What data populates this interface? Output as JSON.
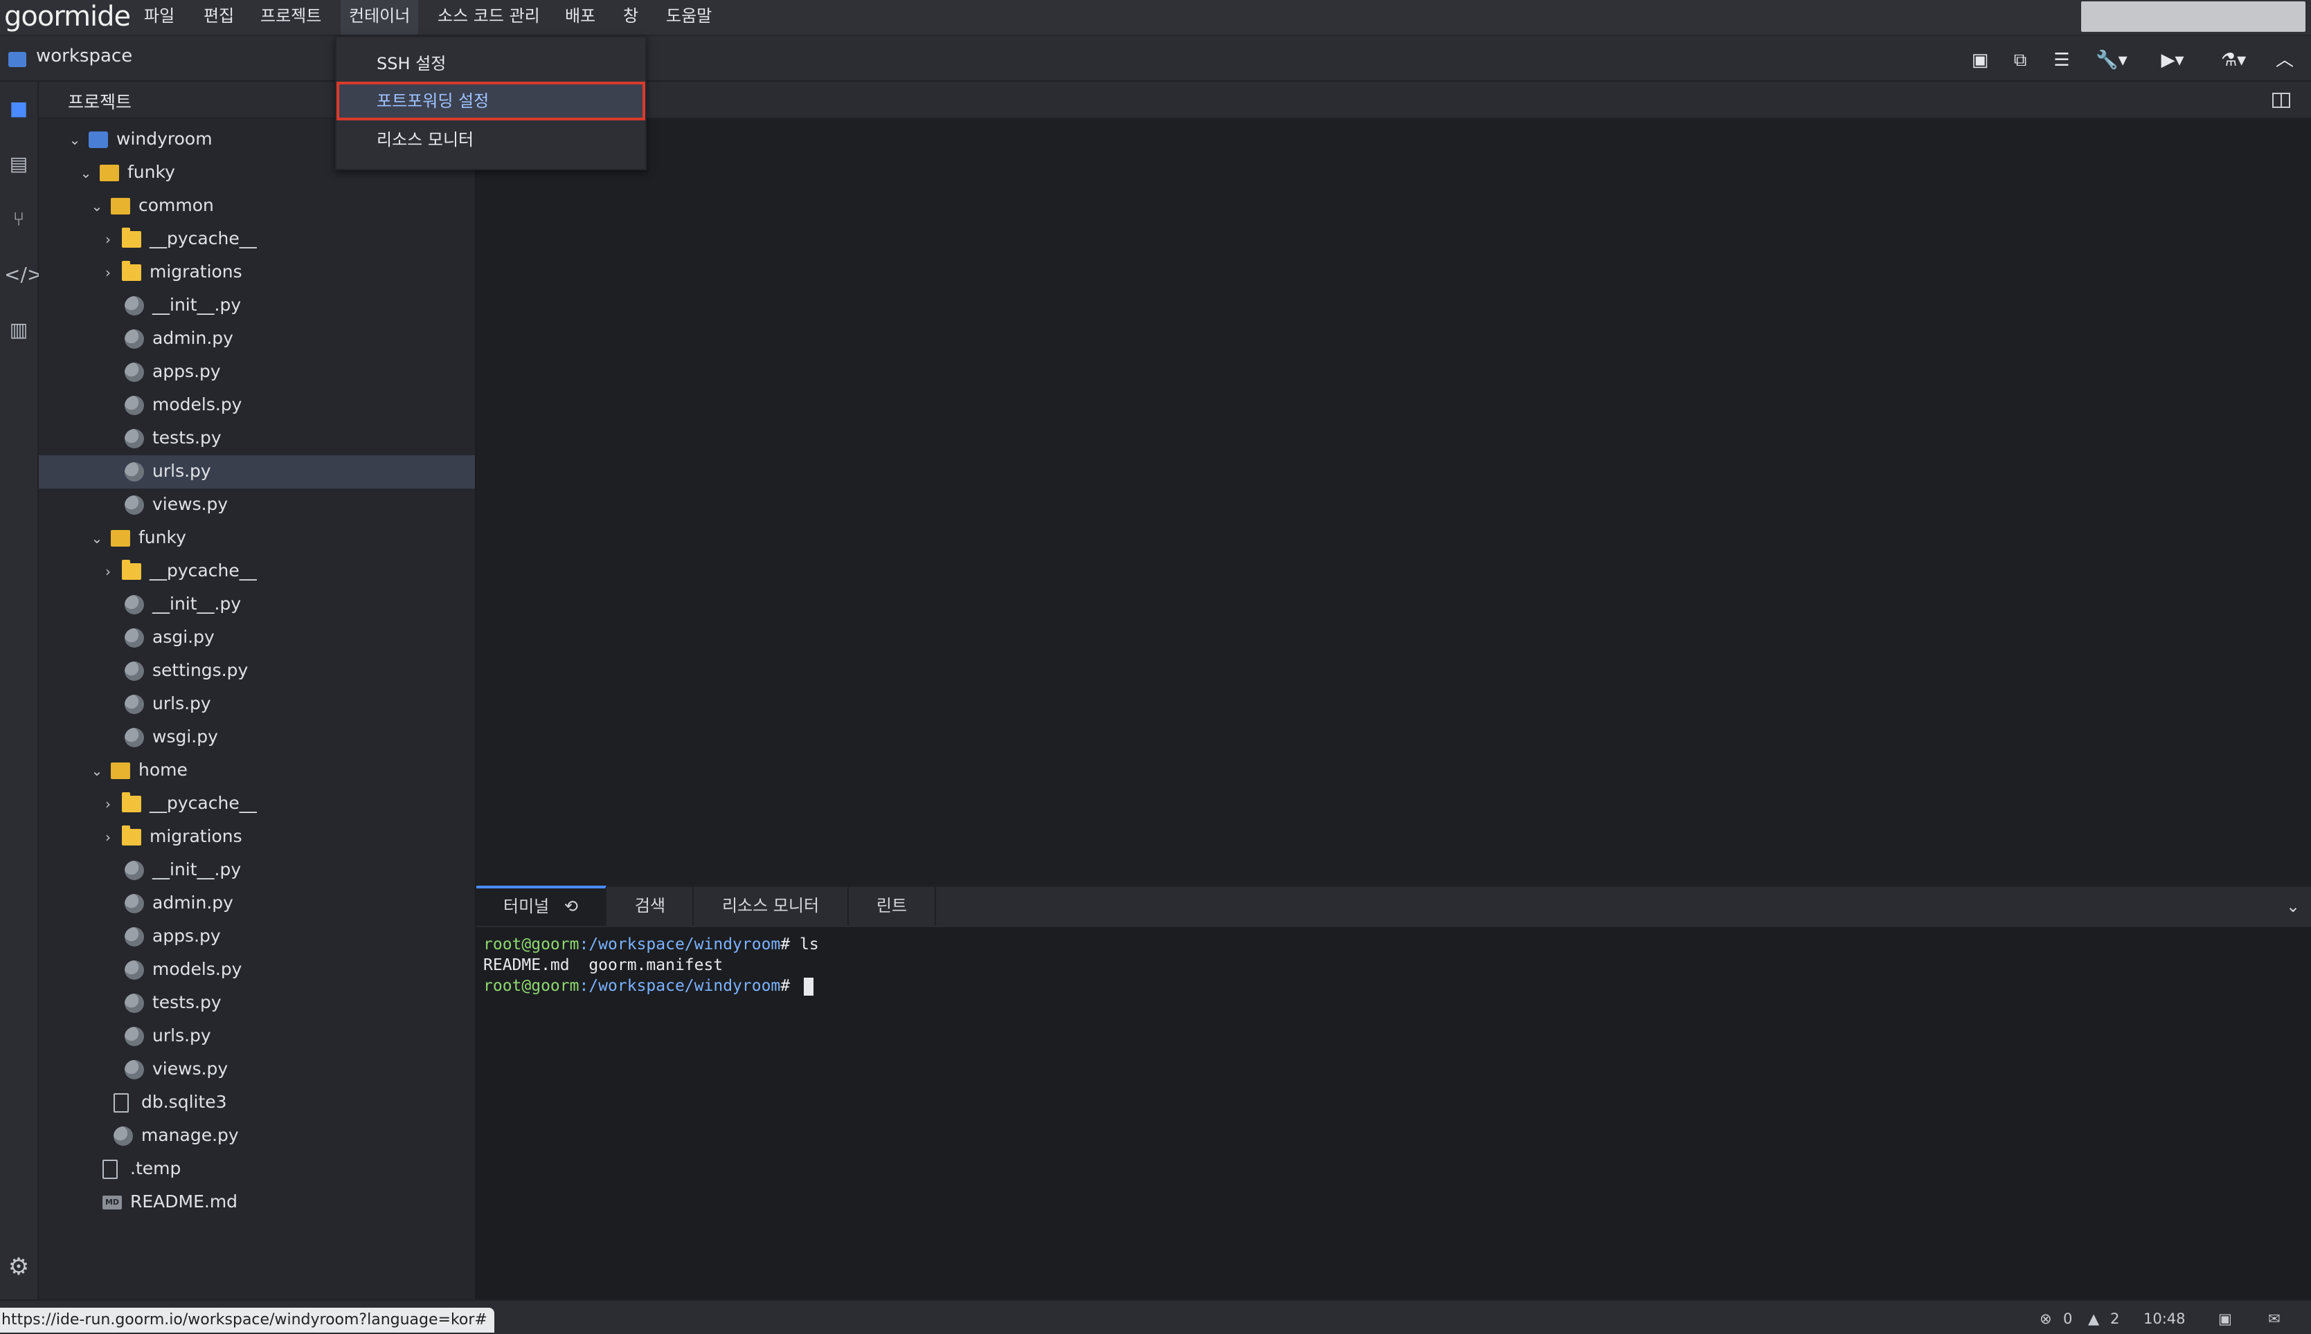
{
  "app": {
    "logo": "goormide"
  },
  "menubar": {
    "items": [
      "파일",
      "편집",
      "프로젝트",
      "컨테이너",
      "소스 코드 관리",
      "배포",
      "창",
      "도움말"
    ],
    "active_index": 3
  },
  "toolbar": {
    "workspace_label": "workspace"
  },
  "dropdown": {
    "items": [
      "SSH 설정",
      "포트포워딩 설정",
      "리소스 모니터"
    ],
    "highlighted_index": 1
  },
  "project_panel": {
    "title": "프로젝트"
  },
  "tree": [
    {
      "label": "windyroom",
      "type": "project",
      "depth": 0,
      "expanded": true
    },
    {
      "label": "funky",
      "type": "folder",
      "depth": 1,
      "expanded": true
    },
    {
      "label": "common",
      "type": "folder",
      "depth": 2,
      "expanded": true
    },
    {
      "label": "__pycache__",
      "type": "folder",
      "depth": 3,
      "expanded": false
    },
    {
      "label": "migrations",
      "type": "folder",
      "depth": 3,
      "expanded": false
    },
    {
      "label": "__init__.py",
      "type": "python",
      "depth": 3
    },
    {
      "label": "admin.py",
      "type": "python",
      "depth": 3
    },
    {
      "label": "apps.py",
      "type": "python",
      "depth": 3
    },
    {
      "label": "models.py",
      "type": "python",
      "depth": 3
    },
    {
      "label": "tests.py",
      "type": "python",
      "depth": 3
    },
    {
      "label": "urls.py",
      "type": "python",
      "depth": 3,
      "selected": true
    },
    {
      "label": "views.py",
      "type": "python",
      "depth": 3
    },
    {
      "label": "funky",
      "type": "folder",
      "depth": 2,
      "expanded": true
    },
    {
      "label": "__pycache__",
      "type": "folder",
      "depth": 3,
      "expanded": false
    },
    {
      "label": "__init__.py",
      "type": "python",
      "depth": 3
    },
    {
      "label": "asgi.py",
      "type": "python",
      "depth": 3
    },
    {
      "label": "settings.py",
      "type": "python",
      "depth": 3
    },
    {
      "label": "urls.py",
      "type": "python",
      "depth": 3
    },
    {
      "label": "wsgi.py",
      "type": "python",
      "depth": 3
    },
    {
      "label": "home",
      "type": "folder",
      "depth": 2,
      "expanded": true
    },
    {
      "label": "__pycache__",
      "type": "folder",
      "depth": 3,
      "expanded": false
    },
    {
      "label": "migrations",
      "type": "folder",
      "depth": 3,
      "expanded": false
    },
    {
      "label": "__init__.py",
      "type": "python",
      "depth": 3
    },
    {
      "label": "admin.py",
      "type": "python",
      "depth": 3
    },
    {
      "label": "apps.py",
      "type": "python",
      "depth": 3
    },
    {
      "label": "models.py",
      "type": "python",
      "depth": 3
    },
    {
      "label": "tests.py",
      "type": "python",
      "depth": 3
    },
    {
      "label": "urls.py",
      "type": "python",
      "depth": 3
    },
    {
      "label": "views.py",
      "type": "python",
      "depth": 3
    },
    {
      "label": "db.sqlite3",
      "type": "file",
      "depth": 2
    },
    {
      "label": "manage.py",
      "type": "python",
      "depth": 2
    },
    {
      "label": ".temp",
      "type": "file",
      "depth": 1
    },
    {
      "label": "README.md",
      "type": "markdown",
      "depth": 1
    }
  ],
  "bottom_panel": {
    "tabs": [
      "터미널",
      "검색",
      "리소스 모니터",
      "린트"
    ],
    "active_tab": 0
  },
  "terminal": {
    "lines": [
      {
        "user": "root@goorm",
        "path": ":/workspace/windyroom",
        "cmd": "# ls"
      },
      {
        "output": "README.md  goorm.manifest"
      },
      {
        "user": "root@goorm",
        "path": ":/workspace/windyroom",
        "cmd": "# ",
        "cursor": true
      }
    ]
  },
  "statusbar": {
    "url": "https://ide-run.goorm.io/workspace/windyroom?language=kor#",
    "errors": "0",
    "warnings": "2",
    "time": "10:48"
  },
  "icons": {
    "toolbar": [
      "save-icon",
      "save-all-icon",
      "find-icon",
      "wrench-icon",
      "run-icon",
      "flask-icon",
      "collapse-icon"
    ],
    "activity": [
      "project-icon",
      "outline-icon",
      "git-icon",
      "code-icon",
      "library-icon",
      "gear-icon"
    ]
  }
}
